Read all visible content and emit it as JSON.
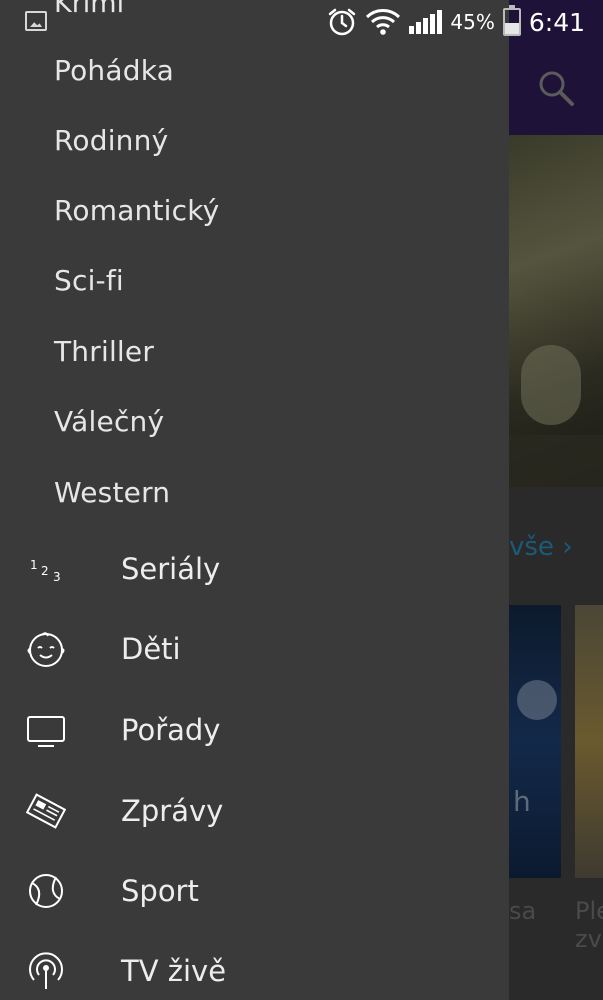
{
  "status_bar": {
    "battery_percent": "45%",
    "time": "6:41",
    "icons": [
      "image-notification-icon",
      "alarm-icon",
      "wifi-icon",
      "signal-icon",
      "battery-icon"
    ]
  },
  "background": {
    "see_all_label": "vše ›",
    "card_titles": [
      "sa",
      "Ple zv"
    ]
  },
  "drawer": {
    "clipped_item": "Krimi",
    "genre_items": [
      {
        "label": "Pohádka"
      },
      {
        "label": "Rodinný"
      },
      {
        "label": "Romantický"
      },
      {
        "label": "Sci-fi"
      },
      {
        "label": "Thriller"
      },
      {
        "label": "Válečný"
      },
      {
        "label": "Western"
      }
    ],
    "main_items": [
      {
        "label": "Seriály",
        "icon": "numbers-icon"
      },
      {
        "label": "Děti",
        "icon": "baby-face-icon"
      },
      {
        "label": "Pořady",
        "icon": "tv-icon"
      },
      {
        "label": "Zprávy",
        "icon": "newspaper-icon"
      },
      {
        "label": "Sport",
        "icon": "ball-icon"
      },
      {
        "label": "TV živě",
        "icon": "broadcast-icon"
      }
    ]
  },
  "colors": {
    "drawer_bg": "#3a3a3a",
    "text": "#e6e6e6",
    "toolbar_dimmed": "#1f1238",
    "link_dimmed": "#1b5a78"
  }
}
